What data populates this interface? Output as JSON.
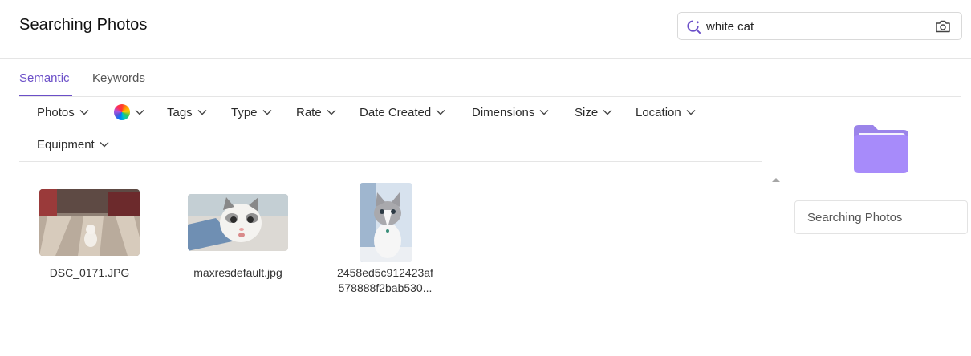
{
  "header": {
    "title": "Searching Photos"
  },
  "search": {
    "value": "white cat"
  },
  "tabs": [
    {
      "label": "Semantic",
      "active": true
    },
    {
      "label": "Keywords",
      "active": false
    }
  ],
  "filters": {
    "photos": "Photos",
    "tags": "Tags",
    "type": "Type",
    "rate": "Rate",
    "date_created": "Date Created",
    "dimensions": "Dimensions",
    "size": "Size",
    "location": "Location",
    "equipment": "Equipment"
  },
  "results": [
    {
      "name": "DSC_0171.JPG"
    },
    {
      "name": "maxresdefault.jpg"
    },
    {
      "name_line1": "2458ed5c912423af",
      "name_line2": "578888f2bab530..."
    }
  ],
  "sidebar": {
    "folder_name": "Searching Photos"
  },
  "colors": {
    "accent": "#6b4fc8",
    "folder": "#a78bfa"
  }
}
